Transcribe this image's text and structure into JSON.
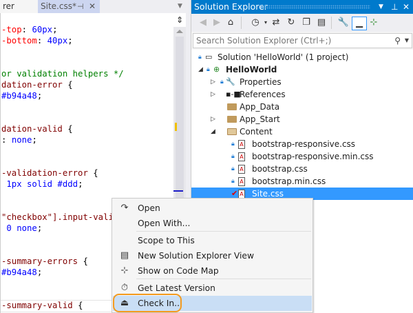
{
  "editor": {
    "tabs": [
      {
        "label": "rer"
      },
      {
        "label": "Site.css*",
        "pin": "⊣",
        "close": "✕"
      }
    ],
    "code": [
      [
        [
          "prop",
          "-top"
        ],
        [
          "pun",
          ": "
        ],
        [
          "val",
          "60px"
        ],
        [
          "pun",
          ";"
        ]
      ],
      [
        [
          "prop",
          "-bottom"
        ],
        [
          "pun",
          ": "
        ],
        [
          "val",
          "40px"
        ],
        [
          "pun",
          ";"
        ]
      ],
      [],
      [],
      [
        [
          "cmt",
          "or validation helpers */"
        ]
      ],
      [
        [
          "sel",
          "dation-error "
        ],
        [
          "pun",
          "{"
        ]
      ],
      [
        [
          "val",
          "#b94a48"
        ],
        [
          "pun",
          ";"
        ]
      ],
      [],
      [],
      [
        [
          "sel",
          "dation-valid "
        ],
        [
          "pun",
          "{"
        ]
      ],
      [
        [
          "pun",
          ": "
        ],
        [
          "val",
          "none"
        ],
        [
          "pun",
          ";"
        ]
      ],
      [],
      [],
      [
        [
          "sel",
          "-validation-error "
        ],
        [
          "pun",
          "{"
        ]
      ],
      [
        [
          "val",
          " 1px solid #ddd"
        ],
        [
          "pun",
          ";"
        ]
      ],
      [],
      [],
      [
        [
          "sel",
          "\"checkbox\"].input-valid"
        ]
      ],
      [
        [
          "val",
          " 0 none"
        ],
        [
          "pun",
          ";"
        ]
      ],
      [],
      [],
      [
        [
          "sel",
          "-summary-errors "
        ],
        [
          "pun",
          "{"
        ]
      ],
      [
        [
          "val",
          "#b94a48"
        ],
        [
          "pun",
          ";"
        ]
      ],
      [],
      [],
      [
        [
          "sel",
          "-summary-valid "
        ],
        [
          "pun",
          "{"
        ]
      ]
    ]
  },
  "solution_explorer": {
    "title": "Solution Explorer",
    "search_placeholder": "Search Solution Explorer (Ctrl+;)",
    "tree": [
      {
        "label": "Solution 'HelloWorld' (1 project)",
        "icon": "solution-icon"
      },
      {
        "label": "HelloWorld",
        "icon": "web-project-icon",
        "bold": true
      },
      {
        "label": "Properties",
        "icon": "wrench-icon"
      },
      {
        "label": "References",
        "icon": "references-icon"
      },
      {
        "label": "App_Data",
        "icon": "folder-icon"
      },
      {
        "label": "App_Start",
        "icon": "folder-icon"
      },
      {
        "label": "Content",
        "icon": "folder-open-icon"
      },
      {
        "label": "bootstrap-responsive.css",
        "icon": "css-file-icon"
      },
      {
        "label": "bootstrap-responsive.min.css",
        "icon": "css-file-icon"
      },
      {
        "label": "bootstrap.css",
        "icon": "css-file-icon"
      },
      {
        "label": "bootstrap.min.css",
        "icon": "css-file-icon"
      },
      {
        "label": "Site.css",
        "icon": "css-file-icon",
        "selected": true
      }
    ]
  },
  "context_menu": {
    "items": [
      {
        "label": "Open",
        "icon": "open-arrow-icon"
      },
      {
        "label": "Open With..."
      },
      {
        "label": "Scope to This"
      },
      {
        "label": "New Solution Explorer View",
        "icon": "new-view-icon"
      },
      {
        "label": "Show on Code Map",
        "icon": "code-map-icon"
      },
      {
        "label": "Get Latest Version",
        "icon": "get-latest-icon"
      },
      {
        "label": "Check In...",
        "icon": "check-in-icon",
        "highlighted": true
      }
    ]
  },
  "colors": {
    "accent": "#007acc",
    "selection": "#3399ff",
    "highlight_ring": "#f39a1e"
  }
}
